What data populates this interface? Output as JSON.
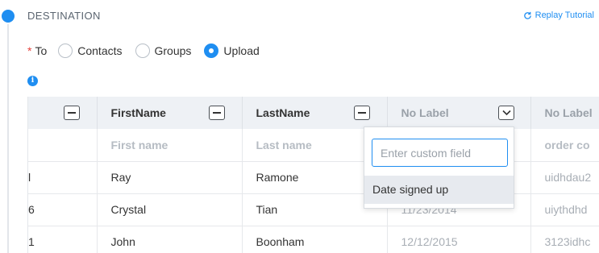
{
  "section": {
    "title": "DESTINATION",
    "replay_label": "Replay Tutorial"
  },
  "to": {
    "required_mark": "*",
    "label": "To",
    "options": [
      "Contacts",
      "Groups",
      "Upload"
    ],
    "selected": "Upload"
  },
  "table": {
    "headers": [
      "",
      "FirstName",
      "LastName",
      "No Label",
      "No Label"
    ],
    "placeholder_row": [
      "",
      "First name",
      "Last name",
      "",
      "order co"
    ],
    "rows": [
      [
        "l",
        "Ray",
        "Ramone",
        "",
        "uidhdau2"
      ],
      [
        "6",
        "Crystal",
        "Tian",
        "11/23/2014",
        "uiythdhd"
      ],
      [
        "1",
        "John",
        "Boonham",
        "12/12/2015",
        "3123idhc"
      ]
    ]
  },
  "dropdown": {
    "input_placeholder": "Enter custom field",
    "options": [
      "Date signed up"
    ]
  },
  "colors": {
    "accent": "#1f8ef1",
    "required": "#e5413b",
    "header_bg": "#eef1f5"
  }
}
